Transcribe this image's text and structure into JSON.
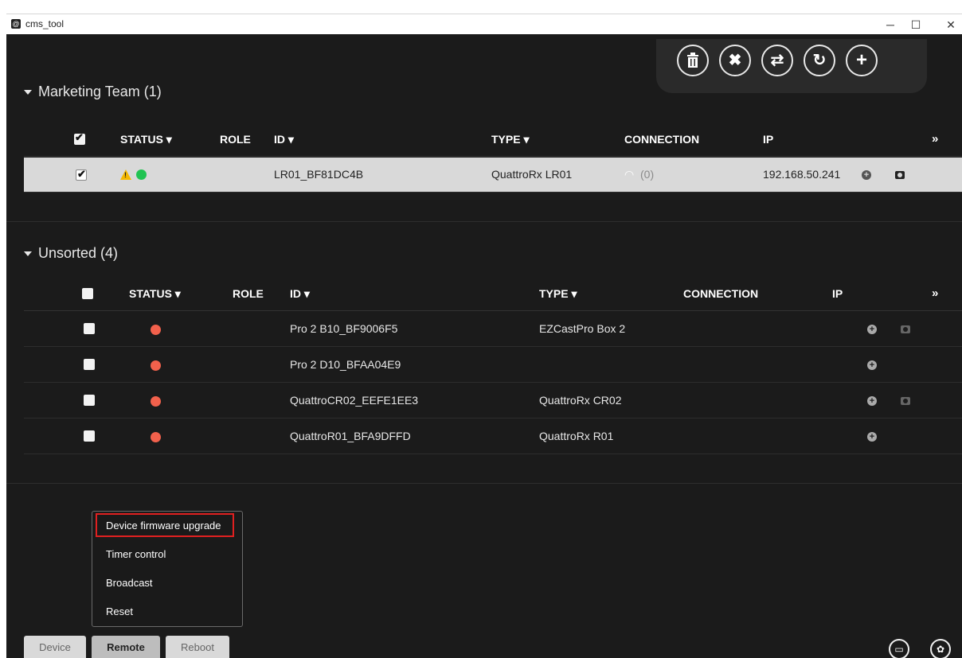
{
  "window": {
    "title": "cms_tool",
    "controls": {
      "minimize": "─",
      "maximize": "☐",
      "close": "✕"
    }
  },
  "toolbar": {
    "buttons": [
      {
        "name": "delete-icon",
        "glyph": "🗑"
      },
      {
        "name": "close-icon",
        "glyph": "✖"
      },
      {
        "name": "swap-icon",
        "glyph": "⇄"
      },
      {
        "name": "refresh-icon",
        "glyph": "↻"
      },
      {
        "name": "add-icon",
        "glyph": "+"
      }
    ]
  },
  "groups": [
    {
      "title": "Marketing Team (1)",
      "headers": {
        "status": "STATUS",
        "role": "ROLE",
        "id": "ID",
        "type": "TYPE",
        "connection": "CONNECTION",
        "ip": "IP",
        "more": "»"
      },
      "rows": [
        {
          "id": "LR01_BF81DC4B",
          "type": "QuattroRx LR01",
          "connection": "(0)",
          "ip": "192.168.50.241",
          "status": "online-warning",
          "checked": true
        }
      ]
    },
    {
      "title": "Unsorted (4)",
      "headers": {
        "status": "STATUS",
        "role": "ROLE",
        "id": "ID",
        "type": "TYPE",
        "connection": "CONNECTION",
        "ip": "IP",
        "more": "»"
      },
      "rows": [
        {
          "id": "Pro 2 B10_BF9006F5",
          "type": "EZCastPro Box 2",
          "status": "offline"
        },
        {
          "id": "Pro 2 D10_BFAA04E9",
          "type": "",
          "status": "offline"
        },
        {
          "id": "QuattroCR02_EEFE1EE3",
          "type": "QuattroRx CR02",
          "status": "offline"
        },
        {
          "id": "QuattroR01_BFA9DFFD",
          "type": "QuattroRx R01",
          "status": "offline"
        }
      ]
    }
  ],
  "context_menu": {
    "items": [
      "Device firmware upgrade",
      "Timer control",
      "Broadcast",
      "Reset"
    ]
  },
  "tabs": [
    "Device",
    "Remote",
    "Reboot"
  ],
  "colors": {
    "offline": "#f2614c",
    "online": "#21c352",
    "warning": "#f5b800",
    "highlight": "#e02020"
  }
}
